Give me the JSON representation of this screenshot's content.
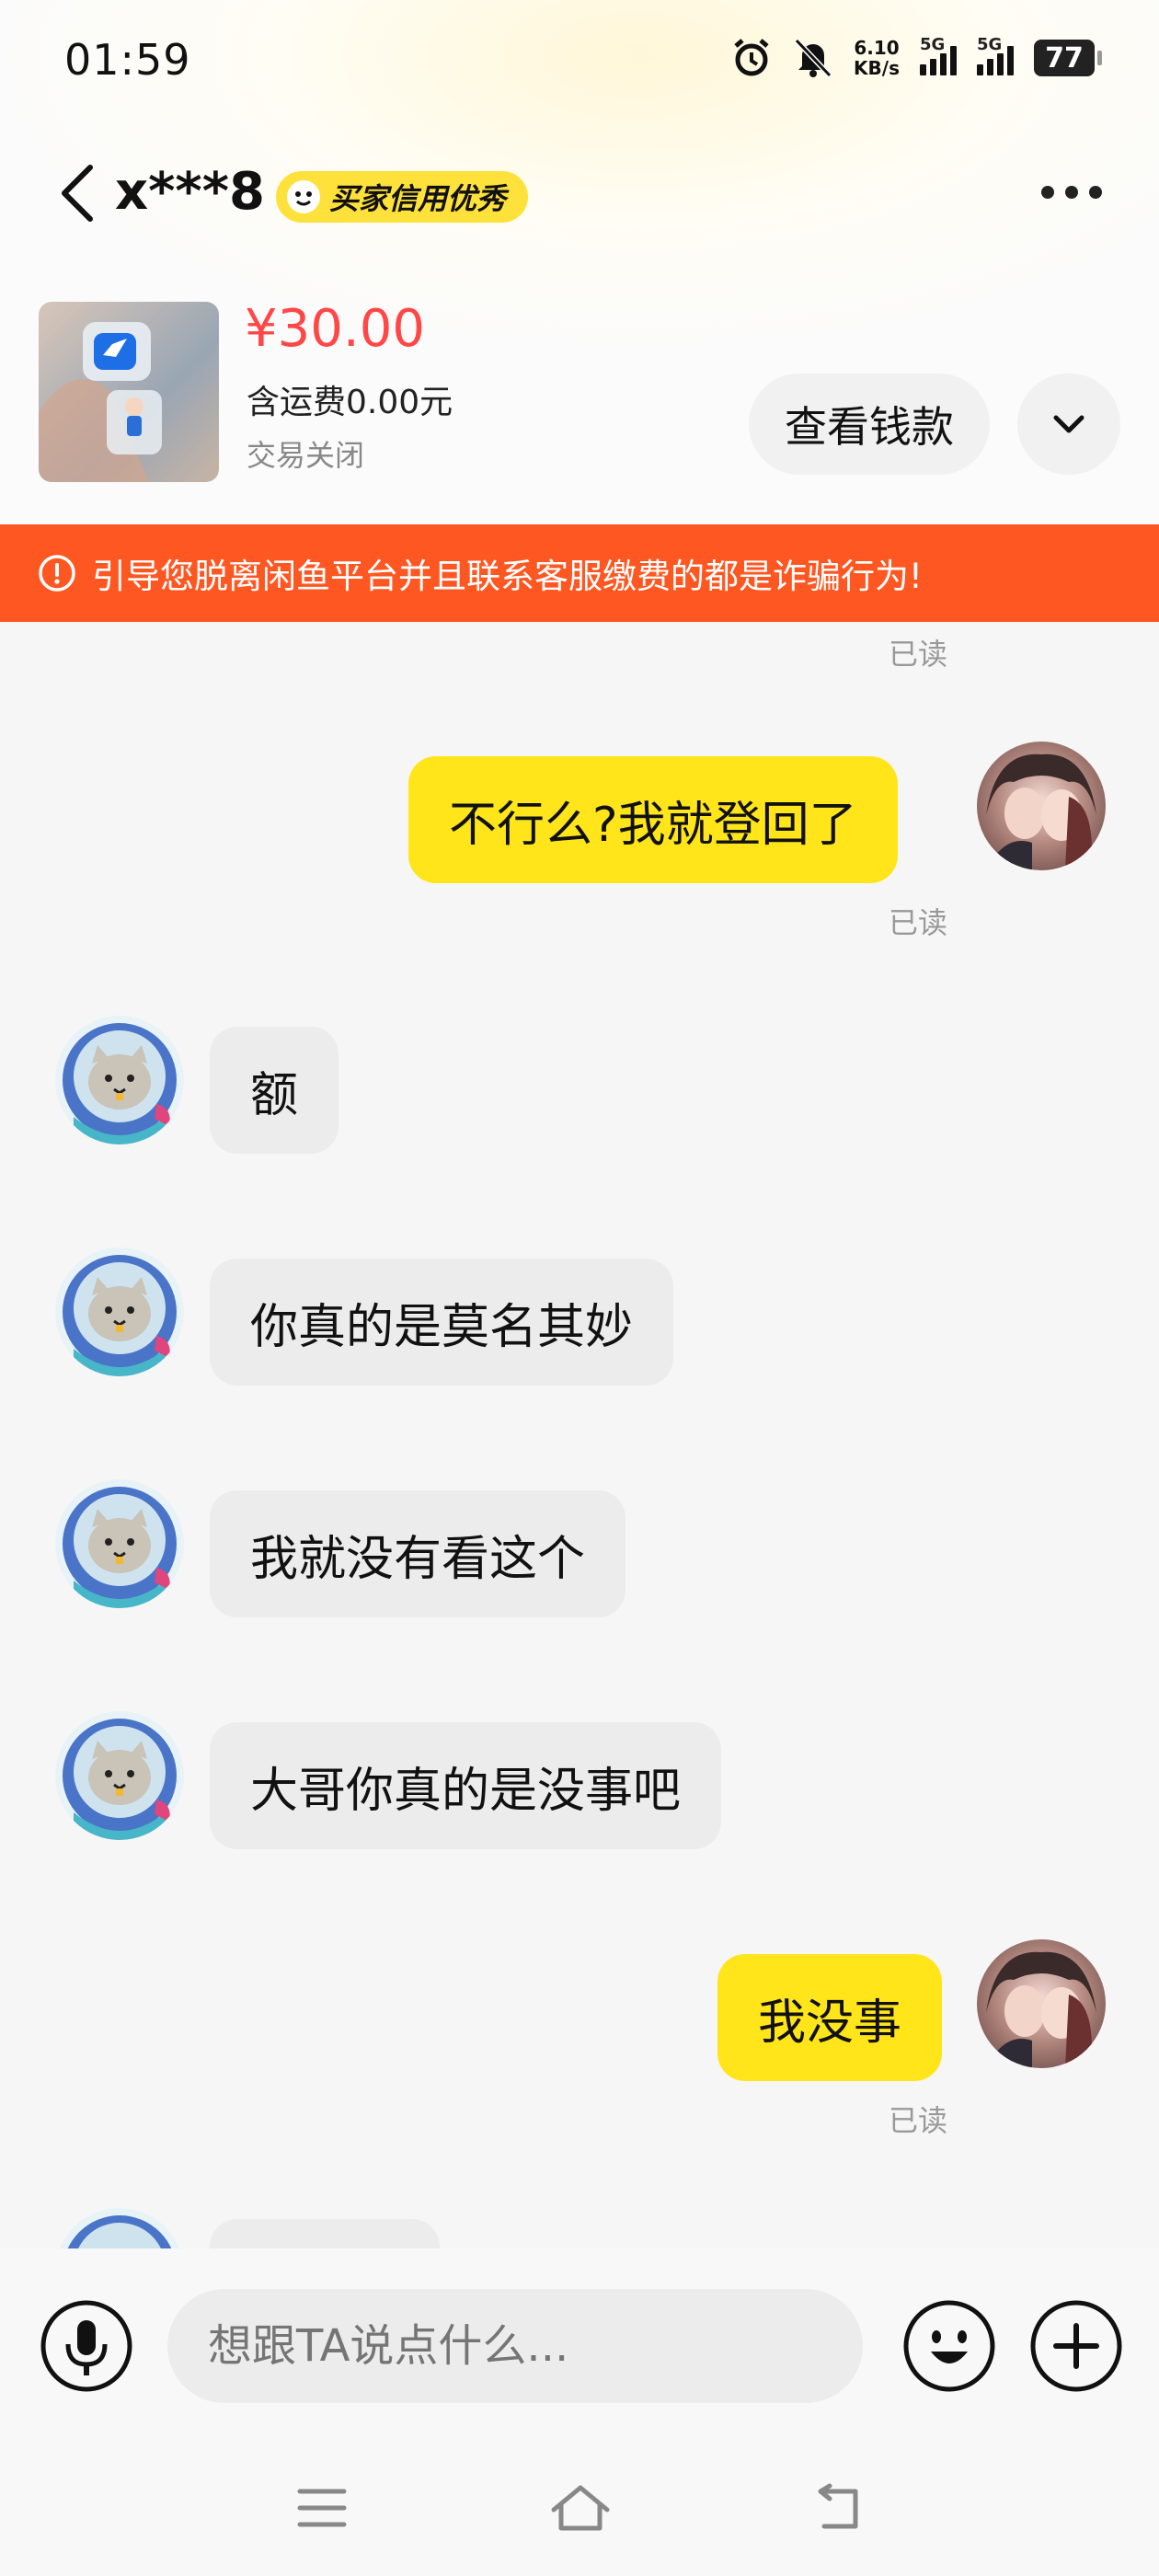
{
  "status_bar": {
    "time": "01:59",
    "net_speed_value": "6.10",
    "net_speed_unit": "KB/s",
    "sim1": "5G",
    "sim2": "5G",
    "battery": "77"
  },
  "header": {
    "contact_name": "x***8",
    "credit_badge": "买家信用优秀"
  },
  "product": {
    "price": "¥30.00",
    "shipping": "含运费0.00元",
    "status": "交易关闭",
    "view_button": "查看钱款"
  },
  "warning": {
    "text": "引导您脱离闲鱼平台并且联系客服缴费的都是诈骗行为!"
  },
  "chat": {
    "read_label": "已读",
    "messages": [
      {
        "from": "me",
        "text": "不行么?我就登回了"
      },
      {
        "from": "them",
        "text": "额"
      },
      {
        "from": "them",
        "text": "你真的是莫名其妙"
      },
      {
        "from": "them",
        "text": "我就没有看这个"
      },
      {
        "from": "them",
        "text": "大哥你真的是没事吧"
      },
      {
        "from": "me",
        "text": "我没事"
      }
    ]
  },
  "input_bar": {
    "placeholder": "想跟TA说点什么..."
  },
  "colors": {
    "brand_yellow": "#ffe51a",
    "warning_bg": "#ff5722",
    "price_red": "#ff4747"
  }
}
